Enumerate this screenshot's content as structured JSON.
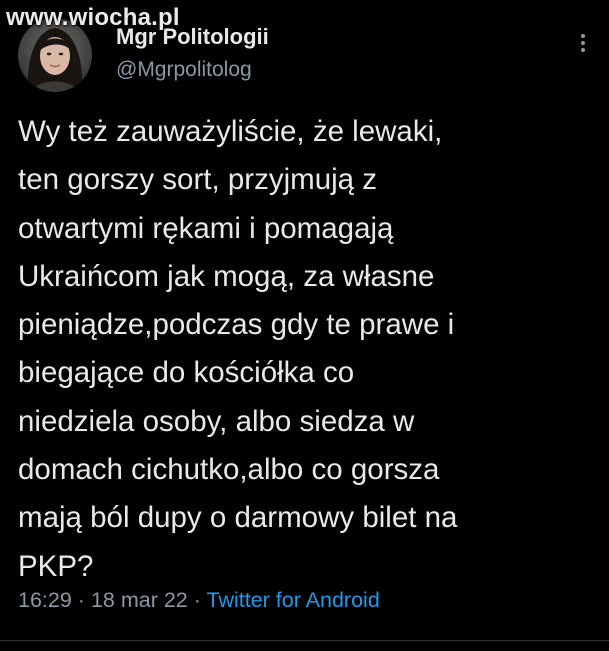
{
  "watermark": "www.wiocha.pl",
  "author": {
    "display_name": "Mgr Politologii",
    "handle": "@Mgrpolitolog"
  },
  "tweet": {
    "text": "Wy też zauważyliście, że lewaki,\nten gorszy sort, przyjmują z\notwartymi rękami i pomagają\nUkraińcom jak mogą, za własne\npieniądze,podczas gdy te prawe i\nbiegające do kościółka co\nniedziela osoby, albo siedza w\ndomach cichutko,albo co gorsza\nmają ból dupy o darmowy bilet na\nPKP?",
    "time": "16:29",
    "separator": "·",
    "date": "18 mar 22",
    "source": "Twitter for Android"
  },
  "icons": {
    "more": "more-vertical-icon",
    "avatar": "profile-avatar"
  },
  "colors": {
    "background": "#000000",
    "text": "#e7e9ea",
    "muted": "#8b98a5",
    "link": "#1d9bf0"
  }
}
